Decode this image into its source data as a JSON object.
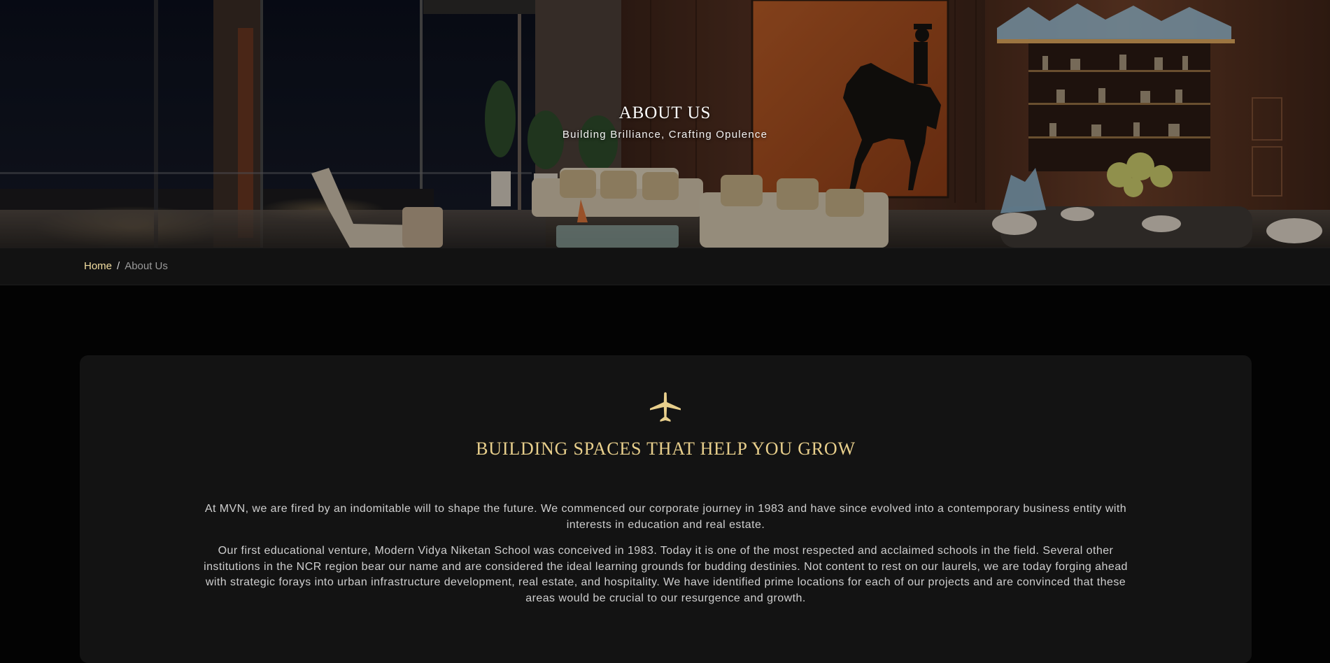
{
  "hero": {
    "title": "ABOUT US",
    "subtitle": "Building Brilliance, Crafting Opulence"
  },
  "breadcrumb": {
    "home": "Home",
    "separator": "/",
    "current": "About Us"
  },
  "about": {
    "icon": "airplane-icon",
    "heading": "BUILDING SPACES THAT HELP YOU GROW",
    "paragraphs": [
      "At MVN, we are fired by an indomitable will to shape the future. We commenced our corporate journey in 1983 and have since evolved into a contemporary business entity with interests in education and real estate.",
      "Our first educational venture, Modern Vidya Niketan School was conceived in 1983. Today it is one of the most respected and acclaimed schools in the field. Several other institutions in the NCR region bear our name and are considered the ideal learning grounds for budding destinies. Not content to rest on our laurels, we are today forging ahead with strategic forays into urban infrastructure development, real estate, and hospitality. We have identified prime locations for each of our projects and are convinced that these areas would be crucial to our resurgence and growth."
    ]
  },
  "colors": {
    "accent_gold": "#e8cf8c",
    "breadcrumb_link": "#f3dea1",
    "page_background": "#030303",
    "card_background": "#131313"
  }
}
